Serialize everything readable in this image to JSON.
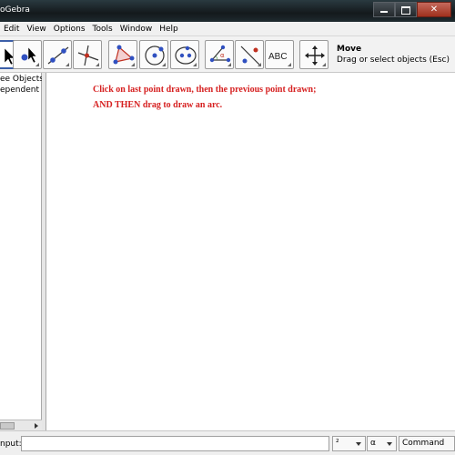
{
  "window": {
    "title": "oGebra"
  },
  "menu": [
    "Edit",
    "View",
    "Options",
    "Tools",
    "Window",
    "Help"
  ],
  "toolbar": {
    "tools": [
      {
        "name": "move-tool",
        "icon": "arrow-cursor-icon",
        "active": true
      },
      {
        "name": "point-tool",
        "icon": "new-point-icon"
      },
      {
        "name": "line-tool",
        "icon": "line-through-two-points-icon"
      },
      {
        "name": "perpendicular-line-tool",
        "icon": "perpendicular-line-icon"
      },
      {
        "name": "polygon-tool",
        "icon": "polygon-icon"
      },
      {
        "name": "circle-tool",
        "icon": "circle-center-point-icon"
      },
      {
        "name": "conic-tool",
        "icon": "ellipse-icon"
      },
      {
        "name": "angle-tool",
        "icon": "angle-icon"
      },
      {
        "name": "reflect-tool",
        "icon": "reflect-about-line-icon"
      },
      {
        "name": "text-tool",
        "icon": "text-abc-icon",
        "label": "ABC"
      },
      {
        "name": "move-graphics-tool",
        "icon": "move-view-icon"
      }
    ],
    "selected_tool_name": "Move",
    "selected_tool_desc": "Drag or select objects (Esc)"
  },
  "algebra": {
    "items": [
      "ee Objects",
      "ependent O"
    ]
  },
  "graphics": {
    "instructions": [
      "Click on last point drawn, then the previous point drawn;",
      "AND THEN drag to draw an arc."
    ]
  },
  "inputbar": {
    "label": "nput:",
    "value": "",
    "symbols_dropdown": "²",
    "greek_dropdown": "α",
    "command_dropdown": "Command ..."
  },
  "colors": {
    "instruction_text": "#d62020",
    "active_tool_border": "#3c5fa8"
  }
}
